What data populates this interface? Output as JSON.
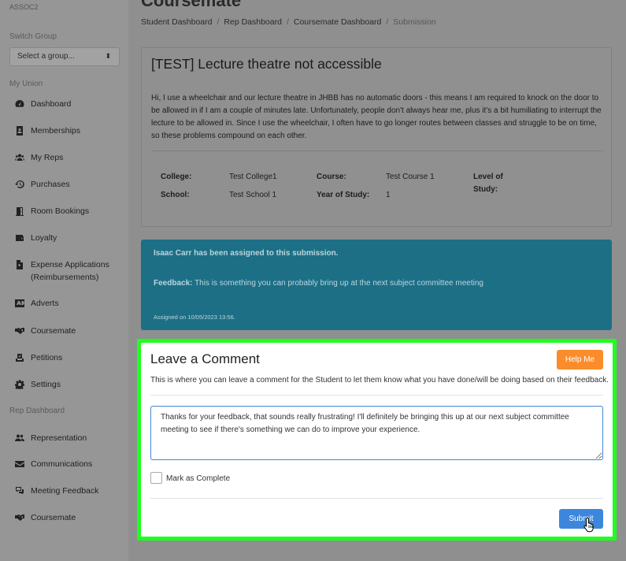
{
  "sidebar": {
    "org": "ASSOC2",
    "switch_group_label": "Switch Group",
    "group_select": "Select a group...",
    "my_union_label": "My Union",
    "items": [
      {
        "label": "Dashboard",
        "icon": "gauge-icon"
      },
      {
        "label": "Memberships",
        "icon": "id-card-icon"
      },
      {
        "label": "My Reps",
        "icon": "users-icon"
      },
      {
        "label": "Purchases",
        "icon": "history-icon"
      },
      {
        "label": "Room Bookings",
        "icon": "door-icon"
      },
      {
        "label": "Loyalty",
        "icon": "wallet-icon"
      },
      {
        "label": "Expense Applications (Reimbursements)",
        "icon": "receipt-icon"
      },
      {
        "label": "Adverts",
        "icon": "ad-icon"
      },
      {
        "label": "Coursemate",
        "icon": "handshake-icon"
      },
      {
        "label": "Petitions",
        "icon": "vote-icon"
      },
      {
        "label": "Settings",
        "icon": "gear-icon"
      }
    ],
    "rep_dashboard_label": "Rep Dashboard",
    "rep_items": [
      {
        "label": "Representation",
        "icon": "users-icon"
      },
      {
        "label": "Communications",
        "icon": "envelope-icon"
      },
      {
        "label": "Meeting Feedback",
        "icon": "comments-icon"
      },
      {
        "label": "Coursemate",
        "icon": "handshake-icon"
      }
    ]
  },
  "header": {
    "title": "Coursemate",
    "breadcrumb": [
      "Student Dashboard",
      "Rep Dashboard",
      "Coursemate Dashboard",
      "Submission"
    ]
  },
  "submission": {
    "title": "[TEST] Lecture theatre not accessible",
    "body": "Hi, I use a wheelchair and our lecture theatre in JHBB has no automatic doors - this means I am required to knock on the door to be allowed in if I am a couple of minutes late. Unfortunately, people don't always hear me, plus it's a bit humiliating to interrupt the lecture to be allowed in. Since I use the wheelchair, I often have to go longer routes between classes and struggle to be on time, so these problems compound on each other.",
    "college_label": "College:",
    "college": "Test College1",
    "school_label": "School:",
    "school": "Test School 1",
    "course_label": "Course:",
    "course": "Test Course 1",
    "year_label": "Year of Study:",
    "year": "1",
    "level_label_1": "Level of",
    "level_label_2": "Study:"
  },
  "assignment": {
    "assigned": "Isaac Carr has been assigned to this submission.",
    "feedback_label": "Feedback:",
    "feedback": "This is something you can probably bring up at the next subject committee meeting",
    "date": "Assigned on 10/05/2023 13:56."
  },
  "comment": {
    "heading": "Leave a Comment",
    "help_label": "Help Me",
    "description": "This is where you can leave a comment for the Student to let them know what you have done/will be doing based on their feedback.",
    "text": "Thanks for your feedback, that sounds really frustrating! I'll definitely be bringing this up at our next subject committee meeting to see if there's something we can do to improve your experience.",
    "mark_complete_label": "Mark as Complete",
    "submit_label": "Submit"
  },
  "colors": {
    "highlight": "#1fff1f",
    "help_button": "#fb8c2b",
    "submit_button": "#3d86dd",
    "assignment_bg": "#1d6f86"
  }
}
